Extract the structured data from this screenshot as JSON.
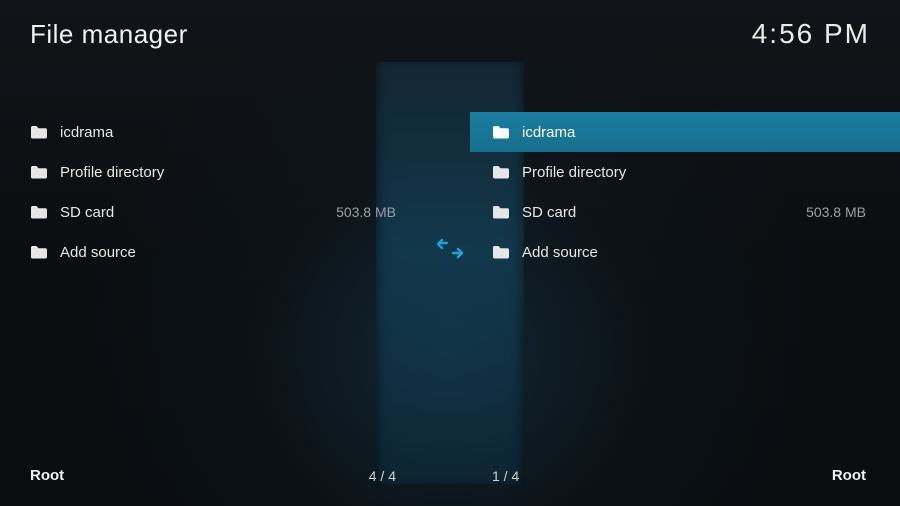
{
  "header": {
    "title": "File manager",
    "clock": "4:56 PM"
  },
  "left": {
    "items": [
      {
        "label": "icdrama",
        "meta": ""
      },
      {
        "label": "Profile directory",
        "meta": ""
      },
      {
        "label": "SD card",
        "meta": "503.8 MB"
      },
      {
        "label": "Add source",
        "meta": ""
      }
    ],
    "footer": {
      "path": "Root",
      "count": "4 / 4"
    }
  },
  "right": {
    "selected_index": 0,
    "items": [
      {
        "label": "icdrama",
        "meta": ""
      },
      {
        "label": "Profile directory",
        "meta": ""
      },
      {
        "label": "SD card",
        "meta": "503.8 MB"
      },
      {
        "label": "Add source",
        "meta": ""
      }
    ],
    "footer": {
      "path": "Root",
      "count": "1 / 4"
    }
  },
  "icons": {
    "folder": "folder-icon",
    "swap": "swap-arrows-icon"
  },
  "colors": {
    "accent": "#1a7ea1",
    "swap_arrow": "#1ea3d8",
    "meta_text": "#9aa0a3"
  }
}
